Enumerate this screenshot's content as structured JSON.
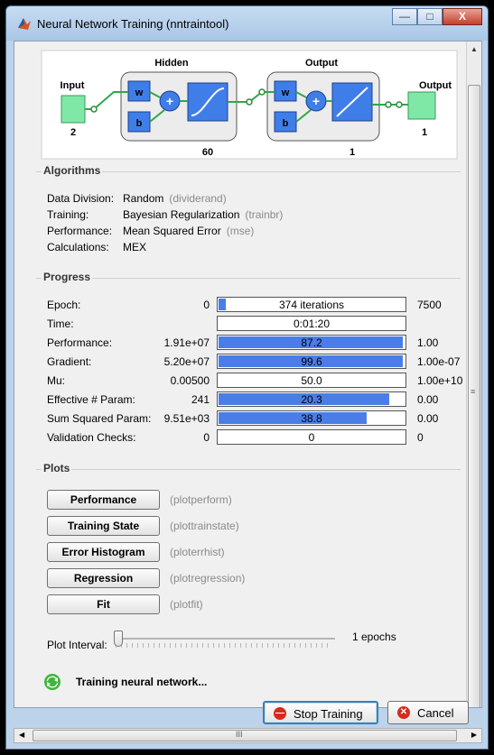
{
  "window": {
    "title": "Neural Network Training (nntraintool)",
    "buttons": {
      "minimize": "—",
      "maximize": "□",
      "close": "X"
    }
  },
  "diagram": {
    "input_label": "Input",
    "input_size": "2",
    "hidden_label": "Hidden",
    "hidden_size": "60",
    "output_layer_label": "Output",
    "output_layer_size": "1",
    "output_label": "Output",
    "output_size": "1",
    "w_label": "w",
    "b_label": "b",
    "plus": "+"
  },
  "algorithms": {
    "title": "Algorithms",
    "rows": [
      {
        "key": "Data Division:",
        "value": "Random",
        "fn": "(dividerand)"
      },
      {
        "key": "Training:",
        "value": "Bayesian Regularization",
        "fn": "(trainbr)"
      },
      {
        "key": "Performance:",
        "value": "Mean Squared Error",
        "fn": "(mse)"
      },
      {
        "key": "Calculations:",
        "value": "MEX",
        "fn": ""
      }
    ]
  },
  "progress": {
    "title": "Progress",
    "rows": [
      {
        "label": "Epoch:",
        "start": "0",
        "bar_text": "374 iterations",
        "end": "7500",
        "fill": 0.05
      },
      {
        "label": "Time:",
        "start": "",
        "bar_text": "0:01:20",
        "end": "",
        "fill": 0
      },
      {
        "label": "Performance:",
        "start": "1.91e+07",
        "bar_text": "87.2",
        "end": "1.00",
        "fill": 0.99
      },
      {
        "label": "Gradient:",
        "start": "5.20e+07",
        "bar_text": "99.6",
        "end": "1.00e-07",
        "fill": 0.99
      },
      {
        "label": "Mu:",
        "start": "0.00500",
        "bar_text": "50.0",
        "end": "1.00e+10",
        "fill": 0
      },
      {
        "label": "Effective # Param:",
        "start": "241",
        "bar_text": "20.3",
        "end": "0.00",
        "fill": 0.92
      },
      {
        "label": "Sum Squared Param:",
        "start": "9.51e+03",
        "bar_text": "38.8",
        "end": "0.00",
        "fill": 0.8
      },
      {
        "label": "Validation Checks:",
        "start": "0",
        "bar_text": "0",
        "end": "0",
        "fill": 0
      }
    ]
  },
  "plots": {
    "title": "Plots",
    "items": [
      {
        "label": "Performance",
        "fn": "(plotperform)"
      },
      {
        "label": "Training State",
        "fn": "(plottrainstate)"
      },
      {
        "label": "Error Histogram",
        "fn": "(ploterrhist)"
      },
      {
        "label": "Regression",
        "fn": "(plotregression)"
      },
      {
        "label": "Fit",
        "fn": "(plotfit)"
      }
    ],
    "interval_label": "Plot Interval:",
    "interval_value": "1 epochs",
    "interval_slider_level": 0
  },
  "status": {
    "text": "Training neural network..."
  },
  "footer": {
    "stop_label": "Stop Training",
    "cancel_label": "Cancel"
  },
  "colors": {
    "bar_fill": "#4a7de6",
    "block_blue": "#3f7ee8",
    "io_green": "#7fe8a6",
    "wire_green": "#2ea84a"
  },
  "scrollbars": {
    "h_grip": "III",
    "v_grip": "≡"
  }
}
